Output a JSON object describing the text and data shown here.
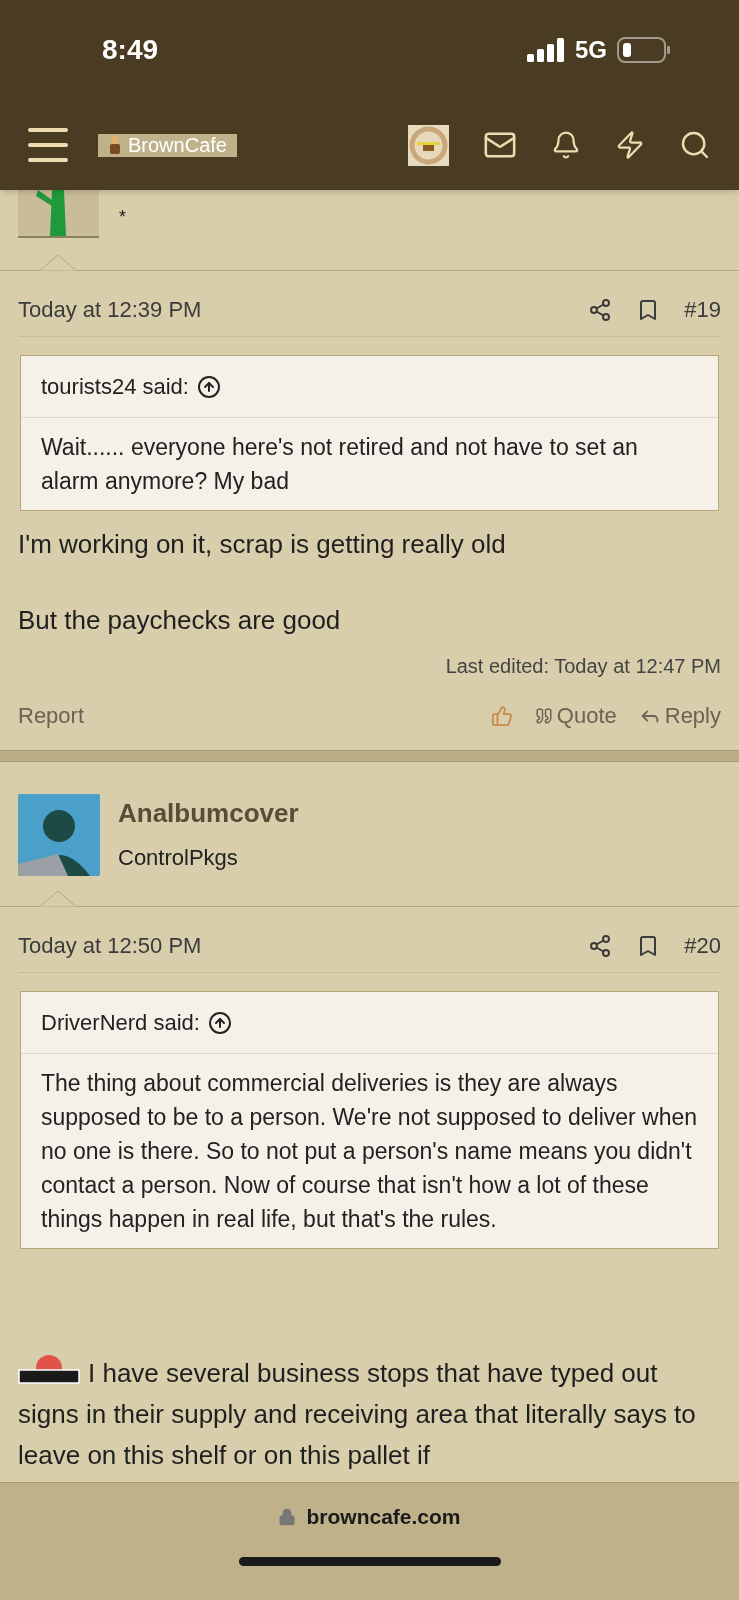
{
  "status_bar": {
    "time": "8:49",
    "network": "5G"
  },
  "nav": {
    "logo": "BrownCafe"
  },
  "top_fragment": {
    "user_title": "*"
  },
  "posts": [
    {
      "kind": "continued",
      "date": "Today at 12:39 PM",
      "number": "#19",
      "quote": {
        "author": "tourists24 said:",
        "text": "Wait...... everyone here's not retired and not have to set an alarm anymore? My bad"
      },
      "body": [
        "I'm working on it, scrap is getting really old",
        "But the paychecks are good"
      ],
      "last_edited": "Last edited: Today at 12:47 PM",
      "report": "Report",
      "actions": [
        "Quote",
        "Reply"
      ]
    },
    {
      "kind": "full",
      "user": {
        "name": "Analbumcover",
        "title": "ControlPkgs"
      },
      "date": "Today at 12:50 PM",
      "number": "#20",
      "quote": {
        "author": "DriverNerd said:",
        "text": "The thing about commercial deliveries is they are always supposed to be to a person. We're not supposed to deliver when no one is there. So to not put a person's name means you didn't contact a person. Now of course that isn't how a lot of these things happen in real life, but that's the rules."
      },
      "body": [
        "I have several business stops that have typed out signs in their supply and receiving area that literally says to leave on this shelf or on this pallet if"
      ]
    }
  ],
  "browser_bar": {
    "url": "browncafe.com"
  }
}
